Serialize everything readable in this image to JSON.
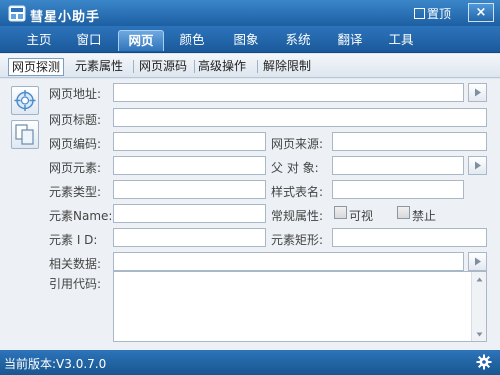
{
  "window": {
    "title": "彗星小助手",
    "pin_label": "置顶",
    "close_label": "×"
  },
  "menu": [
    {
      "label": "主页"
    },
    {
      "label": "窗口"
    },
    {
      "label": "网页",
      "active": true
    },
    {
      "label": "颜色"
    },
    {
      "label": "图象"
    },
    {
      "label": "系统"
    },
    {
      "label": "翻译"
    },
    {
      "label": "工具"
    }
  ],
  "subtabs": [
    {
      "label": "网页探测",
      "active": true
    },
    {
      "label": "元素属性"
    },
    {
      "label": "网页源码"
    },
    {
      "label": "高级操作"
    },
    {
      "label": "解除限制"
    }
  ],
  "form": {
    "url_label": "网页地址:",
    "url_value": "",
    "title_label": "网页标题:",
    "title_value": "",
    "encoding_label": "网页编码:",
    "encoding_value": "",
    "source_label": "网页来源:",
    "source_value": "",
    "element_label": "网页元素:",
    "element_value": "",
    "parent_label": "父 对 象:",
    "parent_value": "",
    "type_label": "元素类型:",
    "type_value": "",
    "style_label": "样式表名:",
    "style_value": "",
    "name_label": "元素Name:",
    "name_value": "",
    "attr_label": "常规属性:",
    "visible_label": "可视",
    "disabled_label": "禁止",
    "id_label": "元素 I D:",
    "id_value": "",
    "rect_label": "元素矩形:",
    "rect_value": "",
    "related_label": "相关数据:",
    "related_value": "",
    "code_label": "引用代码:",
    "code_value": ""
  },
  "status": {
    "version": "当前版本:V3.0.7.0"
  },
  "colors": {
    "accent": "#1d5fa3",
    "menu_active": "#6ea8e0",
    "panel": "#edf1f5"
  },
  "icons": {
    "probe": "crosshair-target-icon",
    "copy": "copy-pages-icon",
    "settings": "gear-icon"
  }
}
